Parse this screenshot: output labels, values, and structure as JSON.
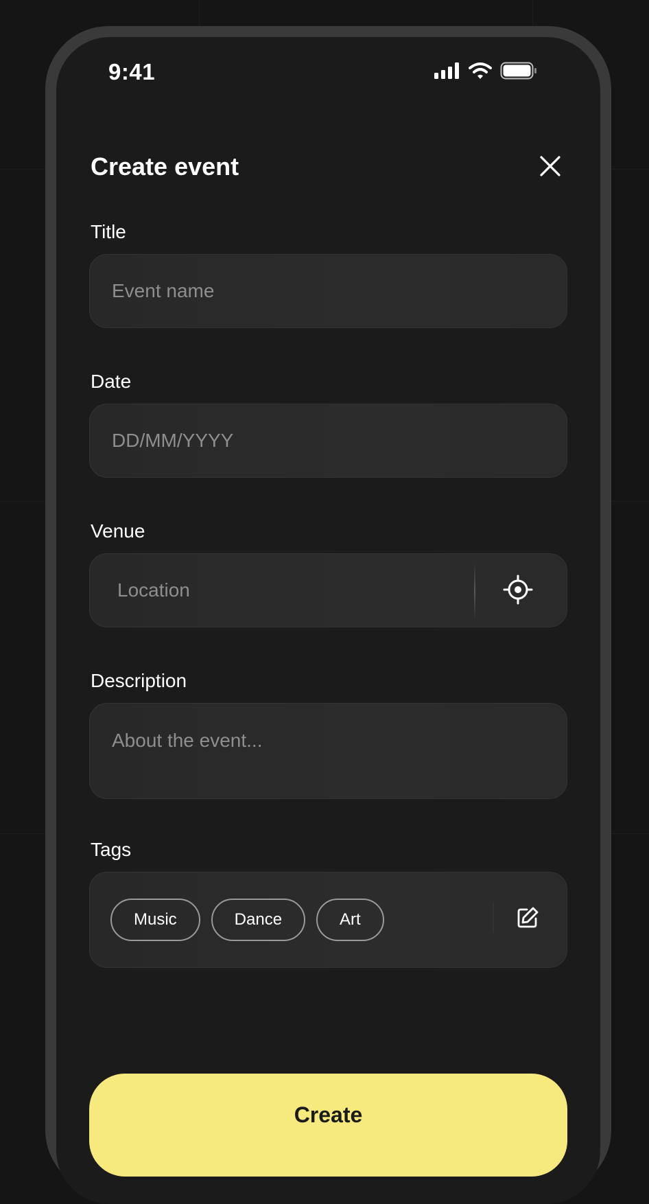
{
  "status_bar": {
    "time": "9:41"
  },
  "header": {
    "title": "Create event"
  },
  "form": {
    "title": {
      "label": "Title",
      "placeholder": "Event name"
    },
    "date": {
      "label": "Date",
      "placeholder": "DD/MM/YYYY"
    },
    "venue": {
      "label": "Venue",
      "placeholder": "Location"
    },
    "description": {
      "label": "Description",
      "placeholder": "About the event..."
    },
    "tags": {
      "label": "Tags",
      "items": [
        "Music",
        "Dance",
        "Art"
      ]
    }
  },
  "actions": {
    "create_label": "Create"
  },
  "colors": {
    "background": "#151515",
    "screen": "#1b1b1b",
    "field": "#2a2a2a",
    "accent": "#f6ea7f",
    "text": "#ffffff",
    "placeholder": "#8e8e8e"
  },
  "icons": {
    "close": "close-icon",
    "locate": "crosshair-icon",
    "edit": "edit-icon",
    "signal": "signal-icon",
    "wifi": "wifi-icon",
    "battery": "battery-icon"
  }
}
